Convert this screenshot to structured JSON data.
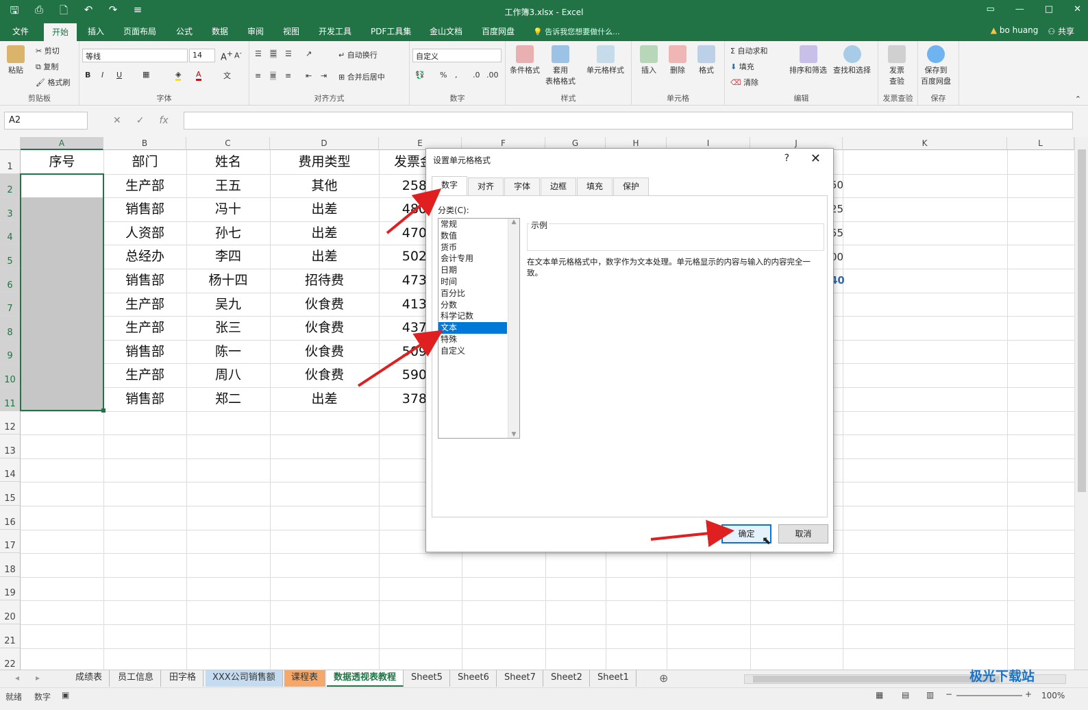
{
  "window": {
    "title": "工作簿3.xlsx - Excel"
  },
  "ribbon_tabs": [
    "文件",
    "开始",
    "插入",
    "页面布局",
    "公式",
    "数据",
    "审阅",
    "视图",
    "开发工具",
    "PDF工具集",
    "金山文档",
    "百度网盘"
  ],
  "tell_me": "告诉我您想要做什么...",
  "user": {
    "name": "bo huang",
    "share": "共享"
  },
  "ribbon": {
    "clipboard": {
      "paste": "粘贴",
      "cut": "剪切",
      "copy": "复制",
      "format_painter": "格式刷",
      "label": "剪贴板"
    },
    "font": {
      "name": "等线",
      "size": "14",
      "bold": "B",
      "italic": "I",
      "underline": "U",
      "label": "字体"
    },
    "alignment": {
      "wrap": "自动换行",
      "merge": "合并后居中",
      "label": "对齐方式"
    },
    "number": {
      "format": "自定义",
      "label": "数字"
    },
    "styles": {
      "conditional": "条件格式",
      "table_line1": "套用",
      "table_line2": "表格格式",
      "cell_styles": "单元格样式",
      "label": "样式"
    },
    "cells": {
      "insert": "插入",
      "delete": "删除",
      "format": "格式",
      "label": "单元格"
    },
    "editing": {
      "autosum": "自动求和",
      "fill": "填充",
      "clear": "清除",
      "sort": "排序和筛选",
      "find": "查找和选择",
      "label": "编辑"
    },
    "invoice": {
      "line1": "发票",
      "line2": "查验",
      "label": "发票查验"
    },
    "save": {
      "line1": "保存到",
      "line2": "百度网盘",
      "label": "保存"
    }
  },
  "formula_bar": {
    "name_box": "A2",
    "fx": "fx",
    "content": ""
  },
  "columns": [
    "A",
    "B",
    "C",
    "D",
    "E",
    "F",
    "G",
    "H",
    "I",
    "J",
    "K",
    "L"
  ],
  "rows": [
    "1",
    "2",
    "3",
    "4",
    "5",
    "6",
    "7",
    "8",
    "9",
    "10",
    "11",
    "12",
    "13",
    "14",
    "15",
    "16",
    "17",
    "18",
    "19",
    "20",
    "21",
    "22"
  ],
  "table": {
    "headers": [
      "序号",
      "部门",
      "姓名",
      "费用类型",
      "发票金"
    ],
    "rows": [
      [
        "",
        "生产部",
        "王五",
        "其他",
        "258"
      ],
      [
        "",
        "销售部",
        "冯十",
        "出差",
        "480"
      ],
      [
        "",
        "人资部",
        "孙七",
        "出差",
        "470"
      ],
      [
        "",
        "总经办",
        "李四",
        "出差",
        "502"
      ],
      [
        "",
        "销售部",
        "杨十四",
        "招待费",
        "473"
      ],
      [
        "",
        "生产部",
        "吴九",
        "伙食费",
        "413"
      ],
      [
        "",
        "生产部",
        "张三",
        "伙食费",
        "437"
      ],
      [
        "",
        "销售部",
        "陈一",
        "伙食费",
        "509"
      ],
      [
        "",
        "生产部",
        "周八",
        "伙食费",
        "590"
      ],
      [
        "",
        "销售部",
        "郑二",
        "出差",
        "378"
      ]
    ],
    "col_j_partial": [
      "50",
      "25",
      "55",
      "00",
      "40"
    ]
  },
  "dialog": {
    "title": "设置单元格格式",
    "help": "?",
    "close": "✕",
    "tabs": [
      "数字",
      "对齐",
      "字体",
      "边框",
      "填充",
      "保护"
    ],
    "category_label": "分类(C):",
    "categories": [
      "常规",
      "数值",
      "货币",
      "会计专用",
      "日期",
      "时间",
      "百分比",
      "分数",
      "科学记数",
      "文本",
      "特殊",
      "自定义"
    ],
    "selected_category": "文本",
    "sample_label": "示例",
    "description": "在文本单元格格式中，数字作为文本处理。单元格显示的内容与输入的内容完全一致。",
    "ok": "确定",
    "cancel": "取消"
  },
  "sheet_tabs": [
    "成绩表",
    "员工信息",
    "田字格",
    "XXX公司销售额",
    "课程表",
    "数据透视表教程",
    "Sheet5",
    "Sheet6",
    "Sheet7",
    "Sheet2",
    "Sheet1"
  ],
  "active_sheet": "数据透视表教程",
  "status": {
    "ready": "就绪",
    "mode": "数字",
    "zoom": "100%"
  },
  "watermark": "极光下载站",
  "colors": {
    "excel_green": "#217346",
    "selection_gray": "#c6c6c6",
    "dialog_selected": "#0078d7",
    "arrow_red": "#e02020"
  }
}
